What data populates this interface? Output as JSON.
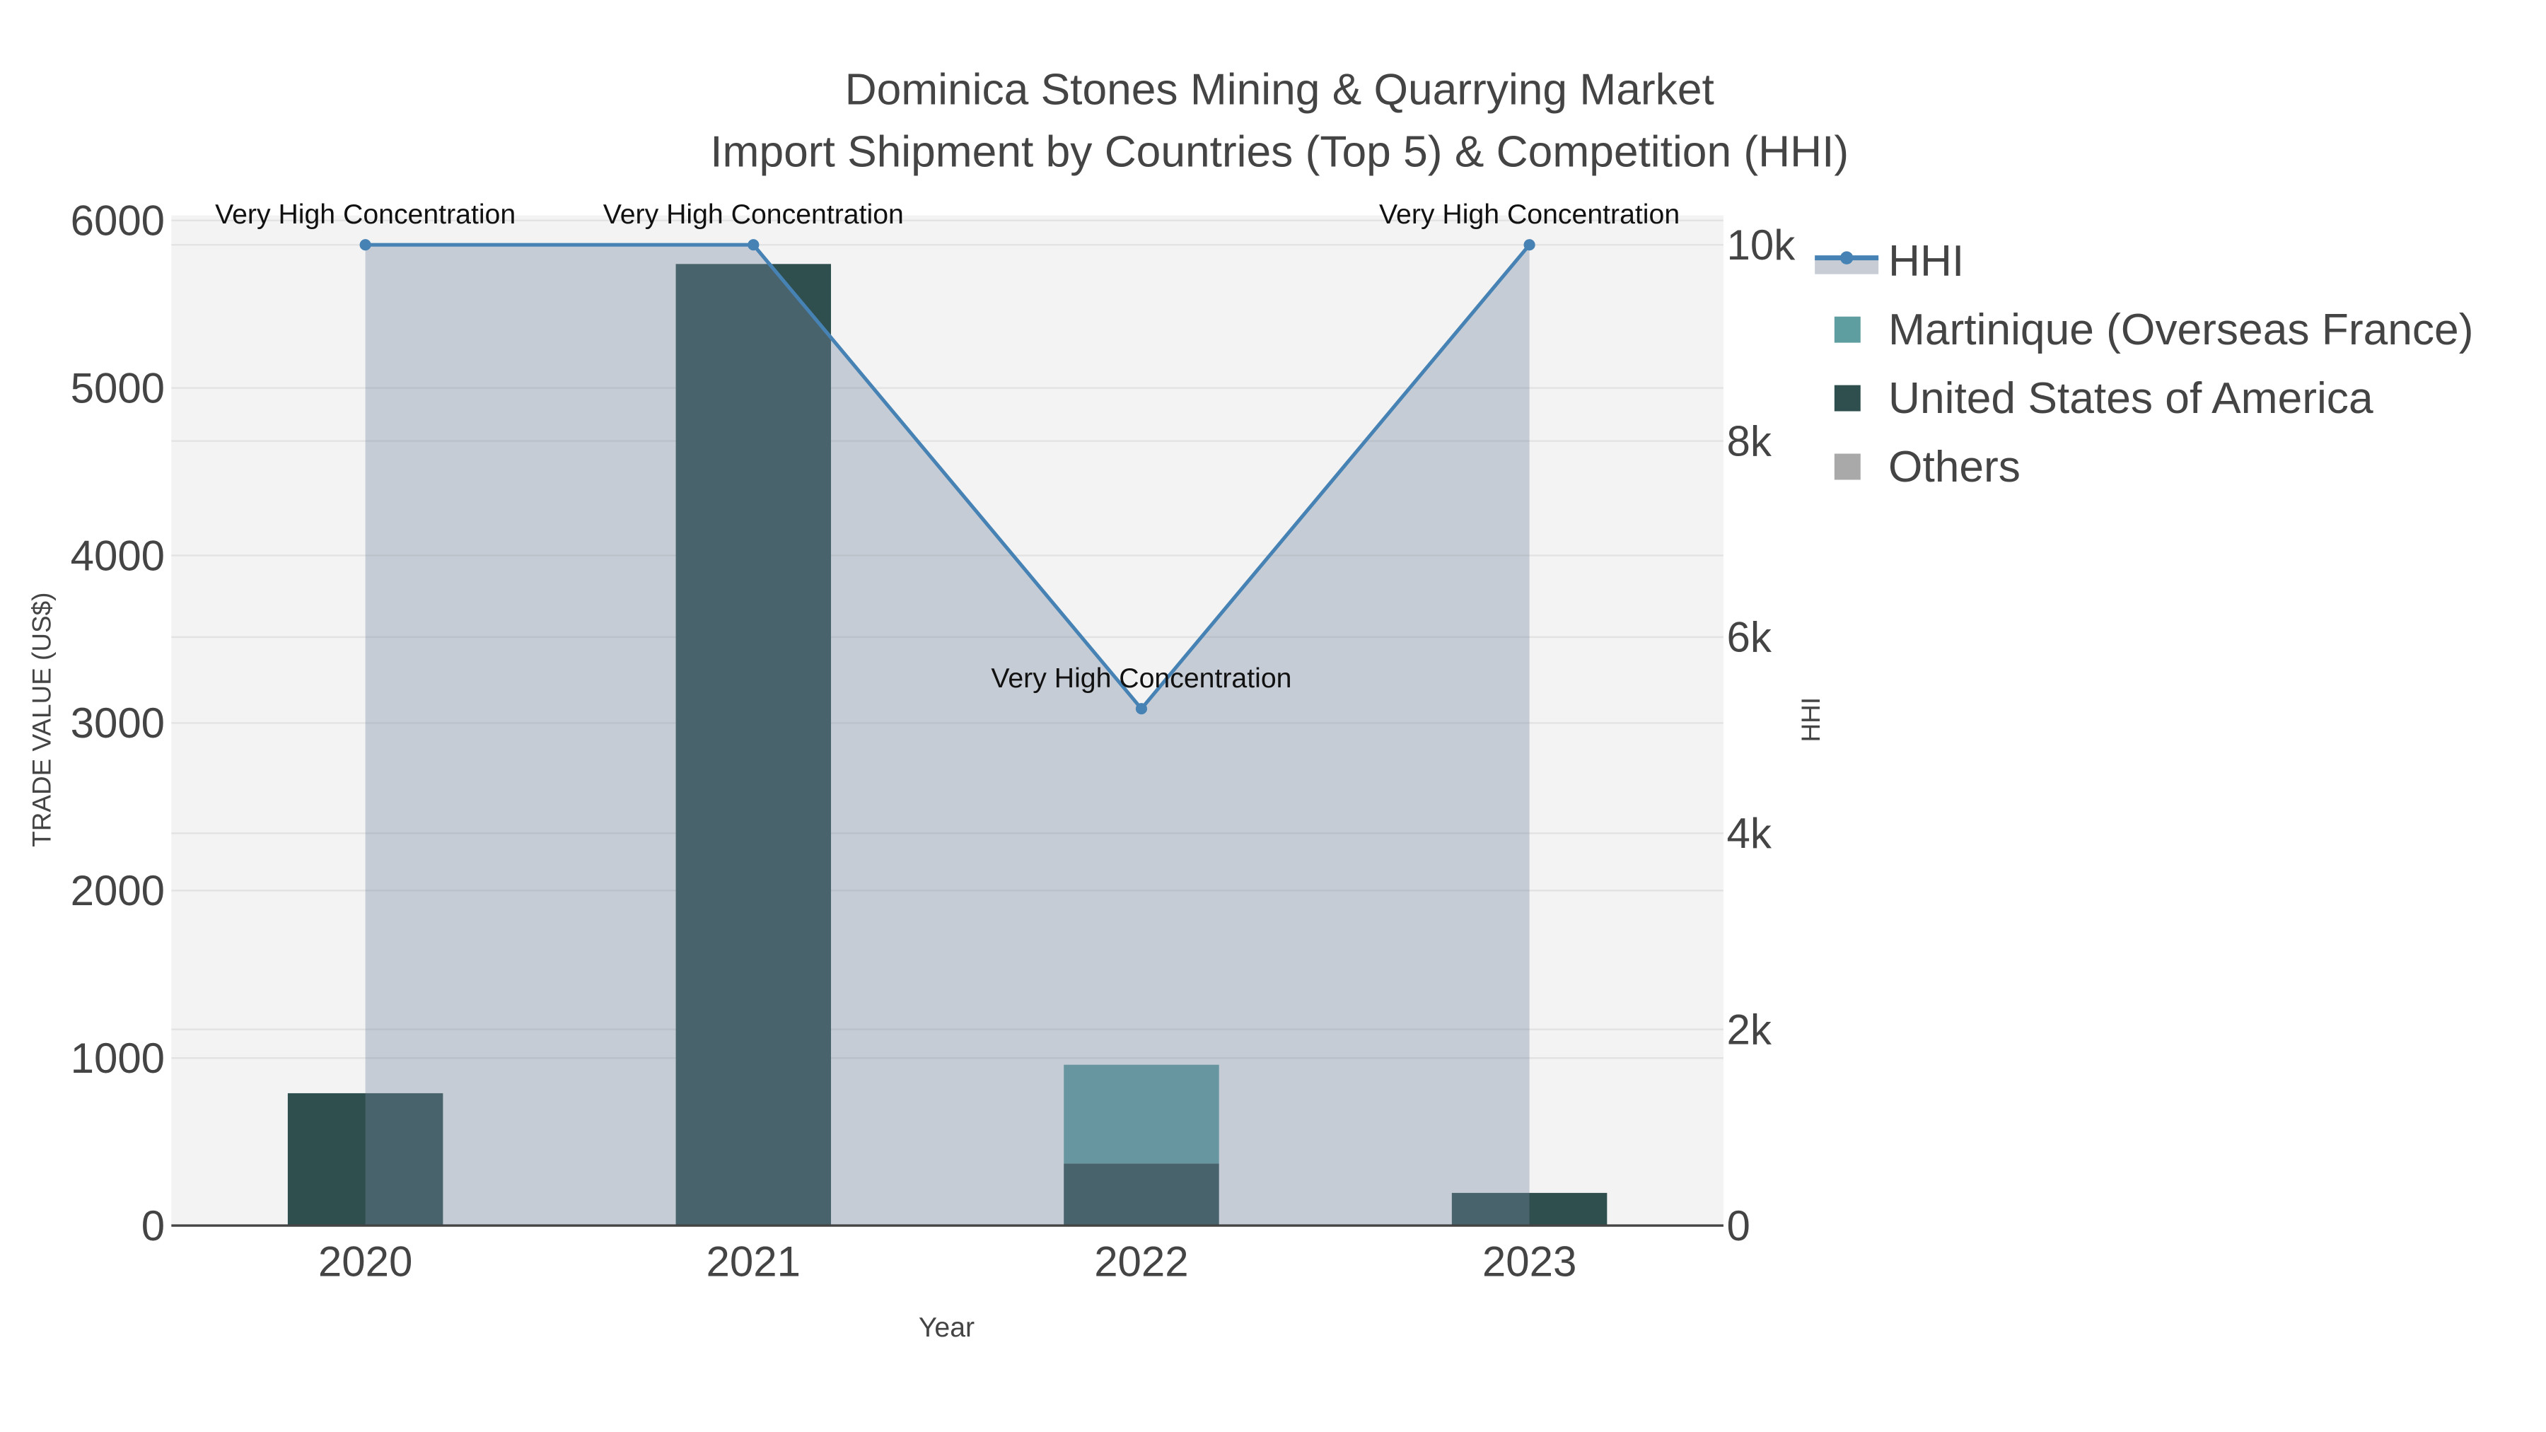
{
  "chart_data": {
    "type": "bar",
    "title": "Dominica Stones Mining & Quarrying Market",
    "subtitle": "Import Shipment by Countries (Top 5) & Competition (HHI)",
    "xlabel": "Year",
    "ylabel": "TRADE VALUE (US$)",
    "y2label": "HHI",
    "categories": [
      "2020",
      "2021",
      "2022",
      "2023"
    ],
    "ylim": [
      0,
      6030
    ],
    "y2lim": [
      0,
      10300
    ],
    "yticks": [
      "0",
      "1000",
      "2000",
      "3000",
      "4000",
      "5000",
      "6000"
    ],
    "y2ticks": [
      "0",
      "2k",
      "4k",
      "6k",
      "8k",
      "10k"
    ],
    "series": [
      {
        "name": "United States of America",
        "type": "bar",
        "color": "#2f4f4f",
        "values": [
          790,
          5740,
          370,
          195
        ]
      },
      {
        "name": "Martinique (Overseas France)",
        "type": "bar",
        "color": "#5f9ea0",
        "values": [
          0,
          0,
          590,
          0
        ]
      },
      {
        "name": "Others",
        "type": "bar",
        "color": "#a9a9a9",
        "values": [
          0,
          0,
          0,
          0
        ]
      },
      {
        "name": "HHI",
        "type": "line",
        "axis": "y2",
        "color": "#4682b4",
        "values": [
          10000,
          10000,
          5270,
          10000
        ],
        "labels": [
          "Very High Concentration",
          "Very High Concentration",
          "Very High Concentration",
          "Very High Concentration"
        ]
      }
    ],
    "legend": {
      "placement": "top-right-outside",
      "items": [
        "HHI",
        "Martinique (Overseas France)",
        "United States of America",
        "Others"
      ]
    },
    "grid": true
  }
}
